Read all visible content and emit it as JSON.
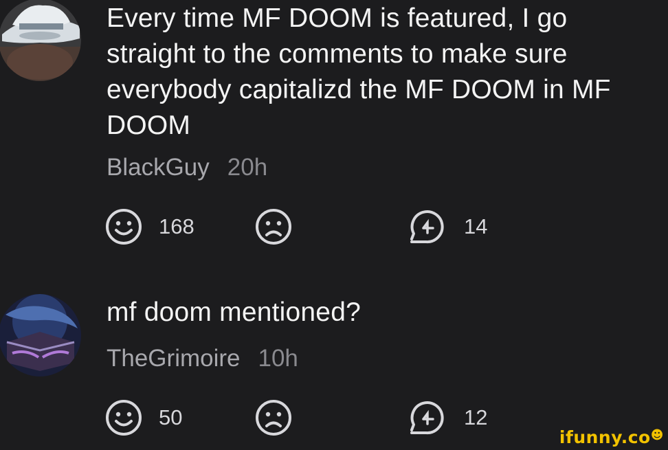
{
  "comments": [
    {
      "text": "Every time MF DOOM is featured, I go\nstraight to the comments to make sure\neverybody capitalizd the MF DOOM in MF\nDOOM",
      "username": "BlackGuy",
      "time": "20h",
      "likes": "168",
      "replies": "14",
      "avatar_icon": "cowboy-hat-avatar"
    },
    {
      "text": "mf doom mentioned?",
      "username": "TheGrimoire",
      "time": "10h",
      "likes": "50",
      "replies": "12",
      "avatar_icon": "grimoire-book-avatar"
    }
  ],
  "watermark": {
    "text": "ifunny.co",
    "color": "#f2c200"
  },
  "icons": {
    "like": "smile-face-icon",
    "dislike": "sad-face-icon",
    "reply": "reply-arrow-icon"
  },
  "colors": {
    "background": "#1c1c1e",
    "text": "#f4f4f4",
    "meta": "#a8a8ad"
  }
}
